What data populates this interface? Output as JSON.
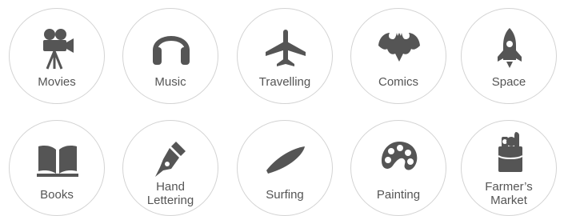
{
  "colors": {
    "icon": "#555555",
    "text": "#555555",
    "border": "#d3d3d3",
    "background": "#ffffff"
  },
  "interests": [
    {
      "label": "Movies",
      "icon": "movie-camera-icon"
    },
    {
      "label": "Music",
      "icon": "headphones-icon"
    },
    {
      "label": "Travelling",
      "icon": "airplane-icon"
    },
    {
      "label": "Comics",
      "icon": "bat-emblem-icon"
    },
    {
      "label": "Space",
      "icon": "rocket-icon"
    },
    {
      "label": "Books",
      "icon": "open-book-icon"
    },
    {
      "label": "Hand\nLettering",
      "icon": "fountain-pen-icon"
    },
    {
      "label": "Surfing",
      "icon": "surfboard-icon"
    },
    {
      "label": "Painting",
      "icon": "paint-palette-icon"
    },
    {
      "label": "Farmer’s\nMarket",
      "icon": "grocery-bag-icon"
    }
  ]
}
